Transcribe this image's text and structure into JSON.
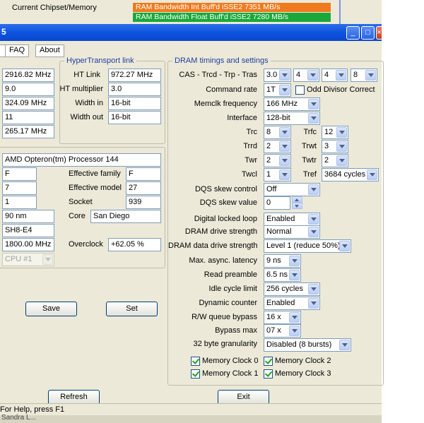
{
  "background_window": {
    "label": "Current Chipset/Memory",
    "bars": [
      {
        "text": "RAM Bandwidth Int Buff'd iSSE2 7351 MB/s",
        "color": "#f07a1e"
      },
      {
        "text": "RAM Bandwidth Float Buff'd iSSE2 7280 MB/s",
        "color": "#1aa83a"
      }
    ]
  },
  "window": {
    "title_fragment": "5",
    "controls": {
      "minimize": "_",
      "maximize": "□",
      "close": "×"
    }
  },
  "menu": [
    "FAQ",
    "About"
  ],
  "cpu_clock": {
    "values": [
      "2916.82 MHz",
      "9.0",
      "324.09 MHz",
      "11",
      "265.17 MHz"
    ]
  },
  "hypertransport": {
    "legend": "HyperTransport link",
    "ht_link_label": "HT Link",
    "ht_link": "972.27 MHz",
    "ht_mult_label": "HT multiplier",
    "ht_mult": "3.0",
    "width_in_label": "Width in",
    "width_in": "16-bit",
    "width_out_label": "Width out",
    "width_out": "16-bit"
  },
  "processor": {
    "name": "AMD Opteron(tm) Processor 144",
    "family": "F",
    "model": "7",
    "stepping": "1",
    "eff_family_label": "Effective family",
    "eff_family": "F",
    "eff_model_label": "Effective model",
    "eff_model": "27",
    "socket_label": "Socket",
    "socket": "939",
    "process": "90 nm",
    "core_label": "Core",
    "core": "San Diego",
    "revision": "SH8-E4",
    "rated_clock": "1800.00 MHz",
    "overclock_label": "Overclock",
    "overclock": "+62.05 %",
    "cpu_select": "CPU #1"
  },
  "buttons": {
    "save": "Save",
    "set": "Set",
    "refresh": "Refresh",
    "exit": "Exit"
  },
  "dram": {
    "legend": "DRAM timings and settings",
    "cas_label": "CAS - Trcd - Trp - Tras",
    "cas": [
      "3.0",
      "4",
      "4",
      "8"
    ],
    "command_rate_label": "Command rate",
    "command_rate": "1T",
    "odd_divisor_label": "Odd Divisor Correct",
    "odd_divisor": false,
    "memclk_label": "Memclk frequency",
    "memclk": "166 MHz",
    "interface_label": "Interface",
    "interface": "128-bit",
    "trc_label": "Trc",
    "trc": "8",
    "trfc_label": "Trfc",
    "trfc": "12",
    "trrd_label": "Trrd",
    "trrd": "2",
    "trwt_label": "Trwt",
    "trwt": "3",
    "twr_label": "Twr",
    "twr": "2",
    "twtr_label": "Twtr",
    "twtr": "2",
    "twcl_label": "Twcl",
    "twcl": "1",
    "tref_label": "Tref",
    "tref": "3684 cycles",
    "dqs_skew_control_label": "DQS skew control",
    "dqs_skew_control": "Off",
    "dqs_skew_value_label": "DQS skew value",
    "dqs_skew_value": "0",
    "dll_label": "Digital locked loop",
    "dll": "Enabled",
    "drive_label": "DRAM drive strength",
    "drive": "Normal",
    "data_drive_label": "DRAM data drive strength",
    "data_drive": "Level 1 (reduce 50%)",
    "async_label": "Max. async. latency",
    "async": "9 ns",
    "preamble_label": "Read preamble",
    "preamble": "6.5 ns",
    "idle_label": "Idle cycle limit",
    "idle": "256 cycles",
    "dyn_counter_label": "Dynamic counter",
    "dyn_counter": "Enabled",
    "rw_queue_label": "R/W queue bypass",
    "rw_queue": "16 x",
    "bypass_max_label": "Bypass max",
    "bypass_max": "07 x",
    "granularity_label": "32 byte granularity",
    "granularity": "Disabled (8 bursts)",
    "mem_clocks": [
      {
        "label": "Memory Clock 0",
        "checked": true
      },
      {
        "label": "Memory Clock 2",
        "checked": true
      },
      {
        "label": "Memory Clock 1",
        "checked": true
      },
      {
        "label": "Memory Clock 3",
        "checked": true
      }
    ]
  },
  "status_bar": "For Help, press F1",
  "taskbar_fragment": "Sandra L..."
}
